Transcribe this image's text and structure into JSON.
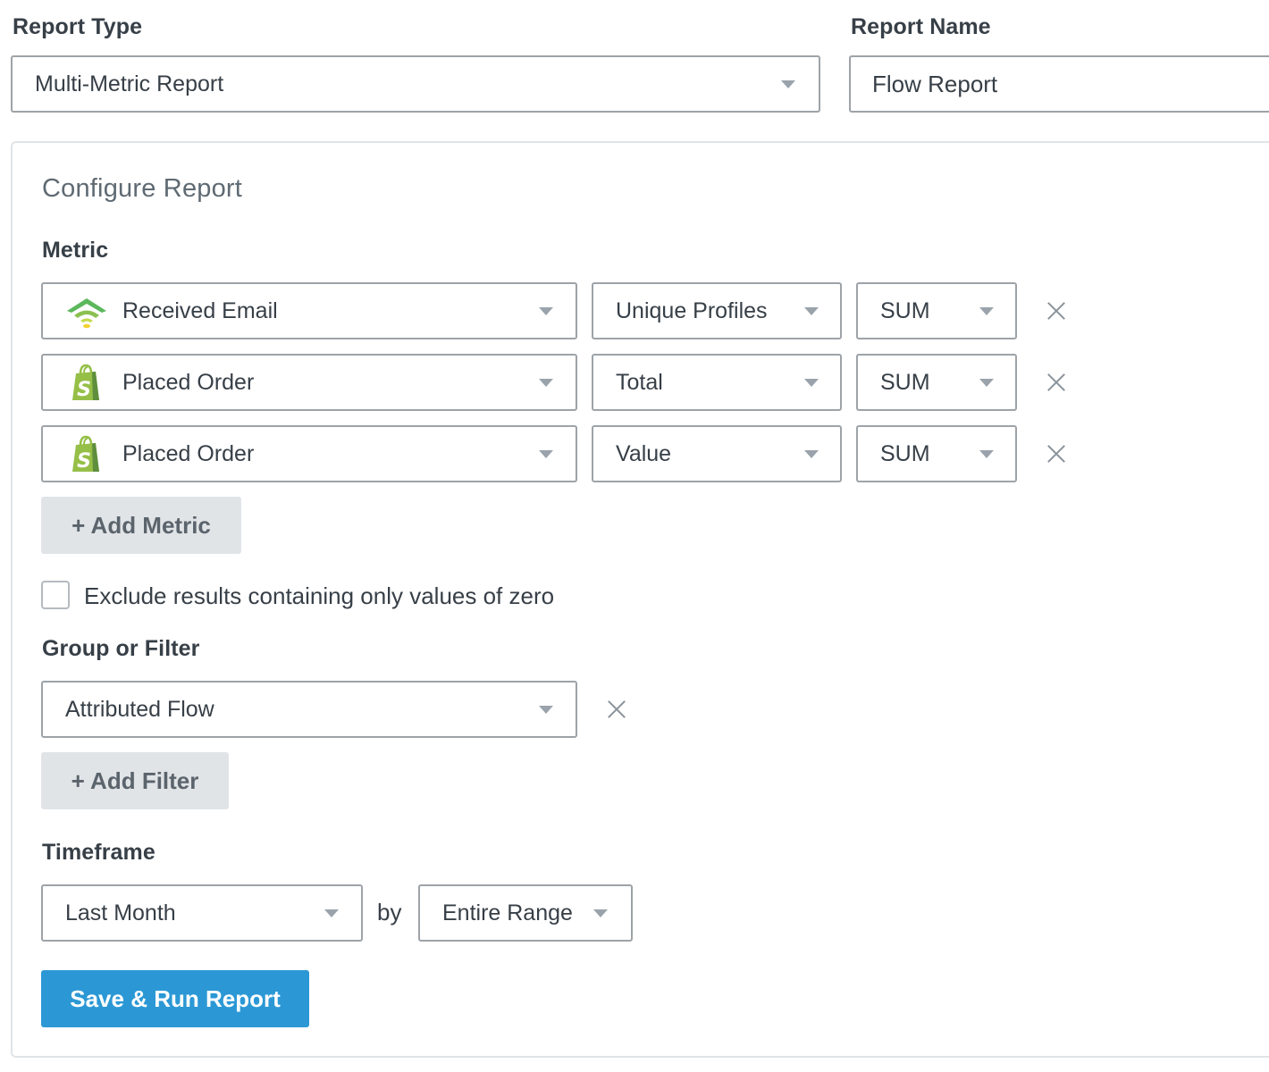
{
  "report_type": {
    "label": "Report Type",
    "value": "Multi-Metric Report"
  },
  "report_name": {
    "label": "Report Name",
    "value": "Flow Report"
  },
  "configure": {
    "title": "Configure Report",
    "metric_label": "Metric",
    "metrics": [
      {
        "icon": "received-email-icon",
        "name": "Received Email",
        "measure": "Unique Profiles",
        "aggregation": "SUM"
      },
      {
        "icon": "shopify-icon",
        "name": "Placed Order",
        "measure": "Total",
        "aggregation": "SUM"
      },
      {
        "icon": "shopify-icon",
        "name": "Placed Order",
        "measure": "Value",
        "aggregation": "SUM"
      }
    ],
    "add_metric_label": "+ Add Metric",
    "exclude_zero": {
      "label": "Exclude results containing only values of zero",
      "checked": false
    },
    "group_filter_label": "Group or Filter",
    "group_filter_value": "Attributed Flow",
    "add_filter_label": "+ Add Filter",
    "timeframe_label": "Timeframe",
    "timeframe_value": "Last Month",
    "by_label": "by",
    "range_value": "Entire Range",
    "submit_label": "Save & Run Report"
  },
  "colors": {
    "primary_button": "#2b98d5",
    "secondary_button": "#e1e4e7",
    "shopify_green": "#95bf47",
    "text": "#373f47"
  }
}
